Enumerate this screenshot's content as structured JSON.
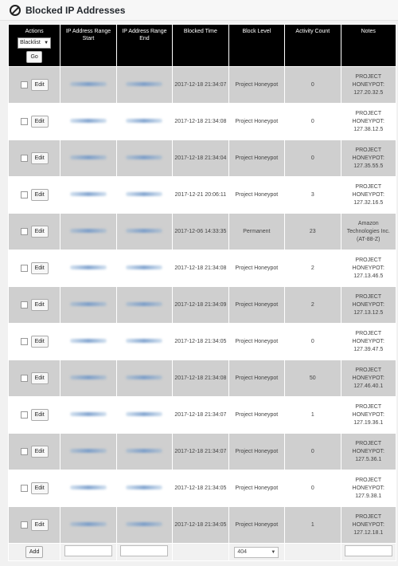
{
  "page": {
    "title": "Blocked IP Addresses",
    "title_icon": "block-icon"
  },
  "header": {
    "actions": "Actions",
    "ip_start": "IP Address Range Start",
    "ip_end": "IP Address Range End",
    "blocked_time": "Blocked Time",
    "block_level": "Block Level",
    "activity_count": "Activity Count",
    "notes": "Notes",
    "list_select": "Blacklist",
    "go_label": "Go"
  },
  "rows": [
    {
      "edit": "Edit",
      "time": "2017-12-18 21:34:07",
      "level": "Project Honeypot",
      "count": "0",
      "notes": "PROJECT HONEYPOT: 127.20.32.5"
    },
    {
      "edit": "Edit",
      "time": "2017-12-18 21:34:08",
      "level": "Project Honeypot",
      "count": "0",
      "notes": "PROJECT HONEYPOT: 127.38.12.5"
    },
    {
      "edit": "Edit",
      "time": "2017-12-18 21:34:04",
      "level": "Project Honeypot",
      "count": "0",
      "notes": "PROJECT HONEYPOT: 127.35.55.5"
    },
    {
      "edit": "Edit",
      "time": "2017-12-21 20:06:11",
      "level": "Project Honeypot",
      "count": "3",
      "notes": "PROJECT HONEYPOT: 127.32.16.5"
    },
    {
      "edit": "Edit",
      "time": "2017-12-06 14:33:35",
      "level": "Permanent",
      "count": "23",
      "notes": "Amazon Technologies Inc. (AT-88-Z)"
    },
    {
      "edit": "Edit",
      "time": "2017-12-18 21:34:08",
      "level": "Project Honeypot",
      "count": "2",
      "notes": "PROJECT HONEYPOT: 127.13.46.5"
    },
    {
      "edit": "Edit",
      "time": "2017-12-18 21:34:09",
      "level": "Project Honeypot",
      "count": "2",
      "notes": "PROJECT HONEYPOT: 127.13.12.5"
    },
    {
      "edit": "Edit",
      "time": "2017-12-18 21:34:05",
      "level": "Project Honeypot",
      "count": "0",
      "notes": "PROJECT HONEYPOT: 127.39.47.5"
    },
    {
      "edit": "Edit",
      "time": "2017-12-18 21:34:08",
      "level": "Project Honeypot",
      "count": "50",
      "notes": "PROJECT HONEYPOT: 127.46.40.1"
    },
    {
      "edit": "Edit",
      "time": "2017-12-18 21:34:07",
      "level": "Project Honeypot",
      "count": "1",
      "notes": "PROJECT HONEYPOT: 127.19.36.1"
    },
    {
      "edit": "Edit",
      "time": "2017-12-18 21:34:07",
      "level": "Project Honeypot",
      "count": "0",
      "notes": "PROJECT HONEYPOT: 127.5.36.1"
    },
    {
      "edit": "Edit",
      "time": "2017-12-18 21:34:05",
      "level": "Project Honeypot",
      "count": "0",
      "notes": "PROJECT HONEYPOT: 127.9.38.1"
    },
    {
      "edit": "Edit",
      "time": "2017-12-18 21:34:05",
      "level": "Project Honeypot",
      "count": "1",
      "notes": "PROJECT HONEYPOT: 127.12.18.1"
    }
  ],
  "footer": {
    "add_label": "Add",
    "level_select": "404"
  }
}
